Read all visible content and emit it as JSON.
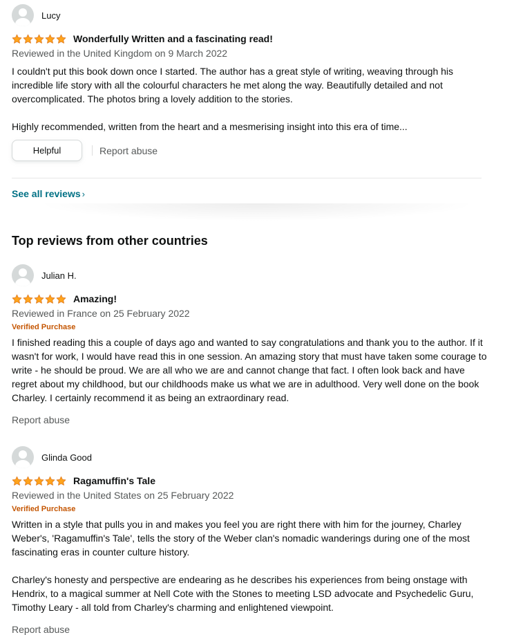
{
  "review1": {
    "profile_name": "Lucy",
    "rating": 5,
    "title": "Wonderfully Written and a fascinating read!",
    "meta": "Reviewed in the United Kingdom on 9 March 2022",
    "body": [
      "I couldn't put this book down once I started. The author has a great style of writing, weaving through his incredible life story with all the colourful characters he met along the way. Beautifully detailed and not overcomplicated. The photos bring a lovely addition to the stories.",
      "Highly recommended, written from the heart and a mesmerising insight into this era of time..."
    ],
    "helpful_label": "Helpful",
    "report_label": "Report abuse"
  },
  "see_all_label": "See all reviews",
  "see_all_chevron": "›",
  "section_heading": "Top reviews from other countries",
  "review2": {
    "profile_name": "Julian H.",
    "rating": 5,
    "title": "Amazing!",
    "meta": "Reviewed in France on 25 February 2022",
    "verified": "Verified Purchase",
    "body": [
      "I finished reading this a couple of days ago and wanted to say congratulations and thank you to the author. If it wasn't for work, I would have read this in one session. An amazing story that must have taken some courage to write - he should be proud. We are all who we are and cannot change that fact. I often look back and have regret about my childhood, but our childhoods make us what we are in adulthood. Very well done on the book Charley. I certainly recommend it as being an extraordinary read."
    ],
    "report_label": "Report abuse"
  },
  "review3": {
    "profile_name": "Glinda Good",
    "rating": 5,
    "title": "Ragamuffin's Tale",
    "meta": "Reviewed in the United States on 25 February 2022",
    "verified": "Verified Purchase",
    "body": [
      "Written in a style that pulls you in and makes you feel you are right there with him for the journey, Charley Weber's, 'Ragamuffin's Tale', tells the story of the Weber clan's nomadic wanderings during one of the most fascinating eras in counter culture history.",
      "Charley's honesty and perspective are endearing as he describes his experiences from being onstage with Hendrix, to a magical summer at Nell Cote with the Stones to meeting LSD advocate and Psychedelic Guru, Timothy Leary - all told from Charley's charming and enlightened viewpoint."
    ],
    "report_label": "Report abuse"
  },
  "colors": {
    "star": "#ffa41c",
    "star_stroke": "#de7921",
    "link": "#007185",
    "verified": "#c45500",
    "muted": "#565959"
  },
  "icons": {
    "avatar": "default-avatar-icon",
    "star": "star-icon",
    "chevron": "chevron-right-icon"
  }
}
